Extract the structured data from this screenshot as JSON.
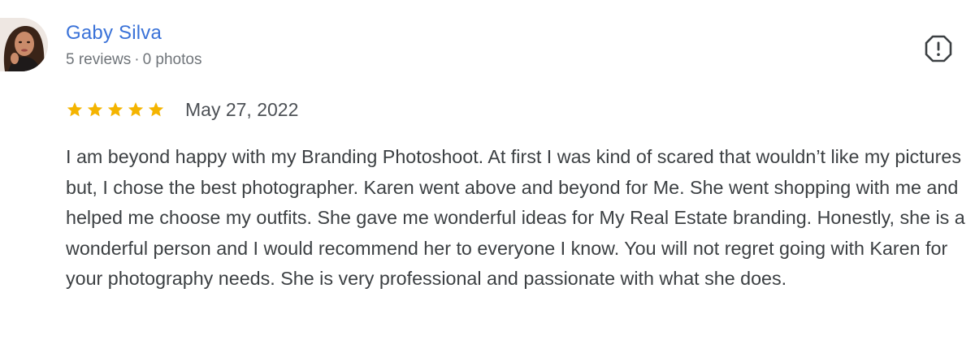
{
  "review": {
    "author": {
      "name": "Gaby Silva",
      "reviews": "5 reviews",
      "separator": "·",
      "photos": "0 photos"
    },
    "rating": {
      "stars": 5,
      "max": 5,
      "color": "#f4b400"
    },
    "date": "May 27, 2022",
    "text": "I am beyond happy with my Branding Photoshoot. At first I was kind of scared that wouldn’t like my pictures but, I chose the best photographer. Karen went above and beyond for Me. She went shopping with me and helped me choose my outfits. She gave me wonderful ideas for My Real Estate branding. Honestly, she is a wonderful person and I would recommend her to everyone I know. You will not regret going with Karen for your photography needs. She is very professional and passionate with what she does.",
    "icons": {
      "avatar": "user-avatar",
      "flag": "report-flag-icon",
      "star": "star-icon"
    },
    "colors": {
      "name": "#3a72d8",
      "meta": "#70757a",
      "text": "#3c4043"
    }
  }
}
